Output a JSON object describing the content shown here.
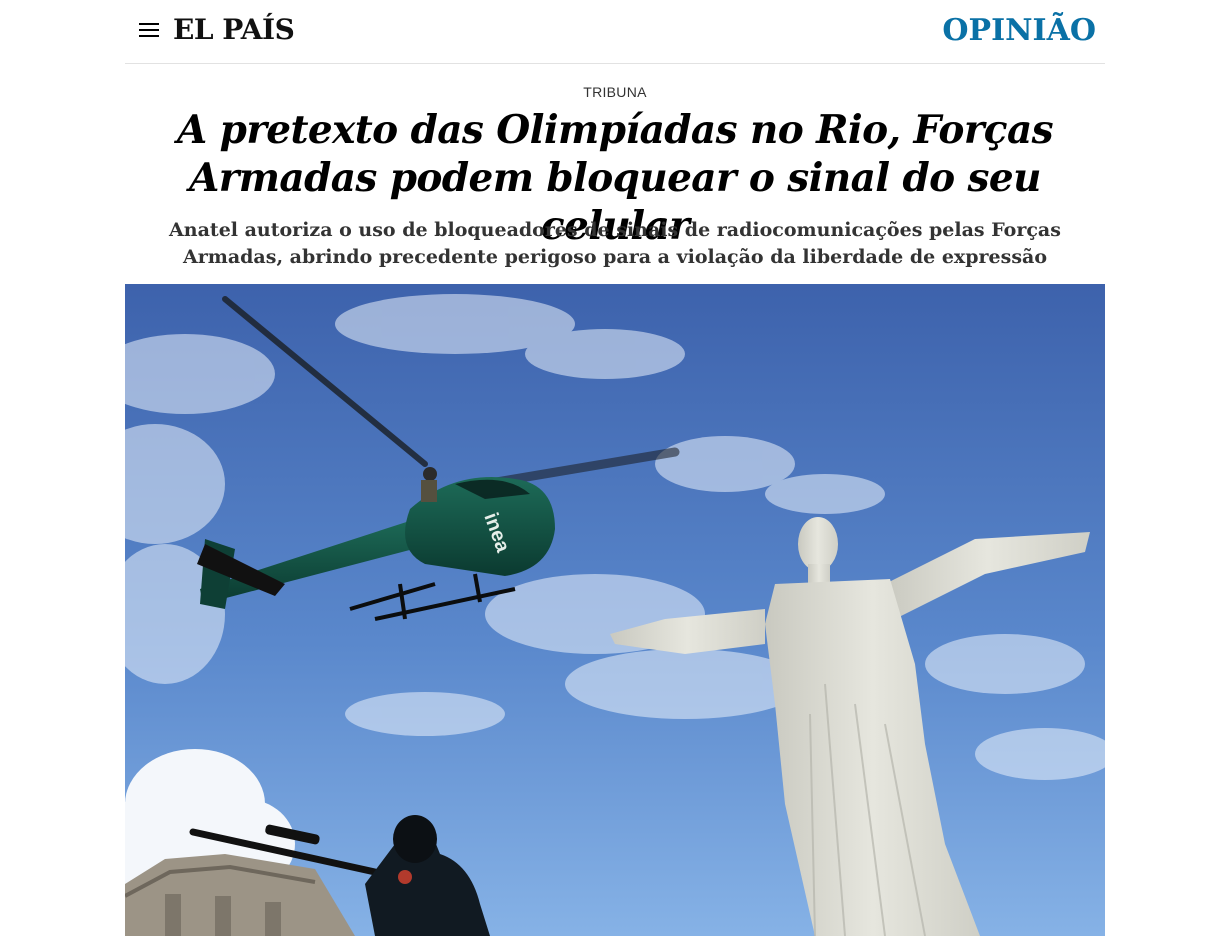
{
  "header": {
    "menu_icon": "hamburger-menu-icon",
    "logo": "EL PAÍS",
    "section": "OPINIÃO"
  },
  "article": {
    "kicker": "TRIBUNA",
    "headline": "A pretexto das Olimpíadas no Rio, Forças Armadas podem bloquear o sinal do seu celular",
    "subheadline": "Anatel autoriza o uso de bloqueadores de sinais de radiocomunicações pelas Forças Armadas, abrindo precedente perigoso para a violação da liberdade de expressão"
  },
  "photo": {
    "sky_top": "#3f64ad",
    "sky_bottom": "#79a7e0",
    "helicopter_color": "#0f4a3e",
    "helicopter_marking": "inea",
    "statue_color": "#dcdcd4"
  },
  "colors": {
    "section_accent": "#0a71a6",
    "text": "#000000",
    "subtext": "#333333",
    "divider": "#e2e2e2"
  }
}
